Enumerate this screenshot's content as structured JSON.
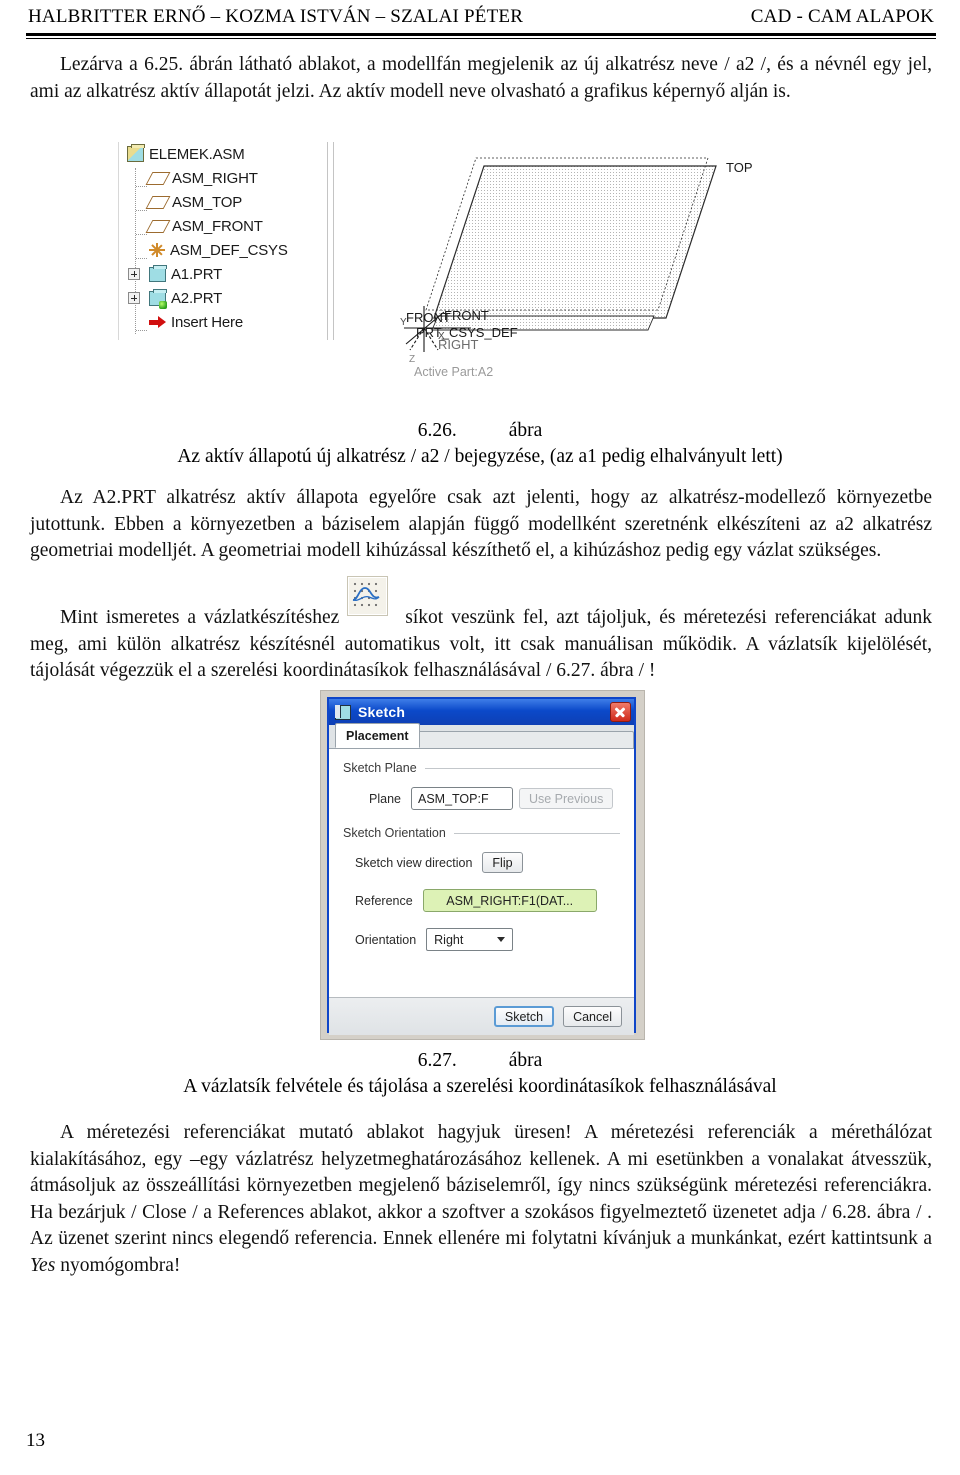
{
  "header": {
    "left_authors": "HALBRITTER ERNŐ – KOZMA ISTVÁN – SZALAI PÉTER",
    "right_title": "CAD - CAM ALAPOK"
  },
  "paragraphs": {
    "p1": "Lezárva a 6.25. ábrán látható ablakot, a modellfán megjelenik az új alkatrész neve / a2 /, és a névnél egy jel, ami az alkatrész aktív állapotát jelzi. Az aktív modell neve olvasható a grafikus képernyő alján is.",
    "p2": "Az A2.PRT alkatrész aktív állapota egyelőre csak azt jelenti, hogy az alkatrész-modellező környezetbe jutottunk. Ebben a környezetben a báziselem alapján függő modellként szeretnénk elkészíteni az a2 alkatrész geometriai modelljét. A geometriai modell kihúzással készíthető el, a kihúzáshoz pedig egy vázlat szükséges.",
    "p3_before_icon": "Mint ismeretes a vázlatkészítéshez",
    "p3_after_icon": "síkot veszünk fel, azt tájoljuk, és méretezési referenciákat adunk meg, ami külön alkatrész készítésnél automatikus volt, itt csak manuálisan működik. A vázlatsík kijelölését, tájolását végezzük el a szerelési koordinátasíkok felhasználásával / 6.27. ábra / !",
    "p4": "A méretezési referenciákat mutató ablakot hagyjuk üresen! A méretezési referenciák a mérethálózat kialakításához, egy –egy vázlatrész helyzetmeghatározásához kellenek. A mi esetünkben a vonalakat átvesszük, átmásoljuk az összeállítási környezetben megjelenő báziselemről, így nincs szükségünk méretezési referenciákra. Ha bezárjuk / Close / a References ablakot, akkor a szoftver a szokásos figyelmeztető üzenetet adja / 6.28. ábra / . Az üzenet szerint nincs elegendő referencia. Ennek ellenére mi folytatni kívánjuk a munkánkat, ezért kattintsunk a ",
    "p4_italic": "Yes",
    "p4_end": " nyomógombra!"
  },
  "figure_626": {
    "caption_number": "6.26.",
    "caption_word": "ábra",
    "caption_text": "Az aktív állapotú új alkatrész / a2 / bejegyzése, (az a1 pedig elhalványult lett)",
    "model_tree": {
      "items": [
        {
          "label": "ELEMEK.ASM",
          "icon": "assembly-icon",
          "level": 0,
          "expander": false
        },
        {
          "label": "ASM_RIGHT",
          "icon": "datum-plane-icon",
          "level": 1,
          "expander": false
        },
        {
          "label": "ASM_TOP",
          "icon": "datum-plane-icon",
          "level": 1,
          "expander": false
        },
        {
          "label": "ASM_FRONT",
          "icon": "datum-plane-icon",
          "level": 1,
          "expander": false
        },
        {
          "label": "ASM_DEF_CSYS",
          "icon": "coordinate-system-icon",
          "level": 1,
          "expander": false
        },
        {
          "label": "A1.PRT",
          "icon": "part-icon",
          "level": 1,
          "expander": true
        },
        {
          "label": "A2.PRT",
          "icon": "active-part-icon",
          "level": 1,
          "expander": true
        },
        {
          "label": "Insert Here",
          "icon": "insert-here-arrow-icon",
          "level": 1,
          "expander": false
        }
      ]
    },
    "graphics": {
      "label_top": "TOP",
      "label_front_1": "FRONT",
      "label_front_2": "FRONT",
      "label_csys": "PRT_CSYS_DEF",
      "label_right": "RIGHT",
      "label_axis_x": "X",
      "label_axis_y": "Y",
      "label_axis_z": "Z",
      "status_text": "Active Part:A2"
    }
  },
  "figure_627": {
    "caption_number": "6.27.",
    "caption_word": "ábra",
    "caption_text": "A vázlatsík felvétele és tájolása a szerelési koordinátasíkok felhasználásával",
    "dialog": {
      "title": "Sketch",
      "title_icon": "sketch-window-icon",
      "close_icon": "close-icon",
      "tab_label": "Placement",
      "group_sketch_plane": "Sketch Plane",
      "plane_label": "Plane",
      "plane_value": "ASM_TOP:F",
      "use_previous_label": "Use Previous",
      "group_sketch_orientation": "Sketch Orientation",
      "view_direction_label": "Sketch view direction",
      "flip_label": "Flip",
      "reference_label": "Reference",
      "reference_value": "ASM_RIGHT:F1(DAT...",
      "orientation_label": "Orientation",
      "orientation_value": "Right",
      "sketch_button": "Sketch",
      "cancel_button": "Cancel"
    }
  },
  "inline_icon": {
    "name": "sketch-tool-icon"
  },
  "footer": {
    "page_number": "13"
  }
}
